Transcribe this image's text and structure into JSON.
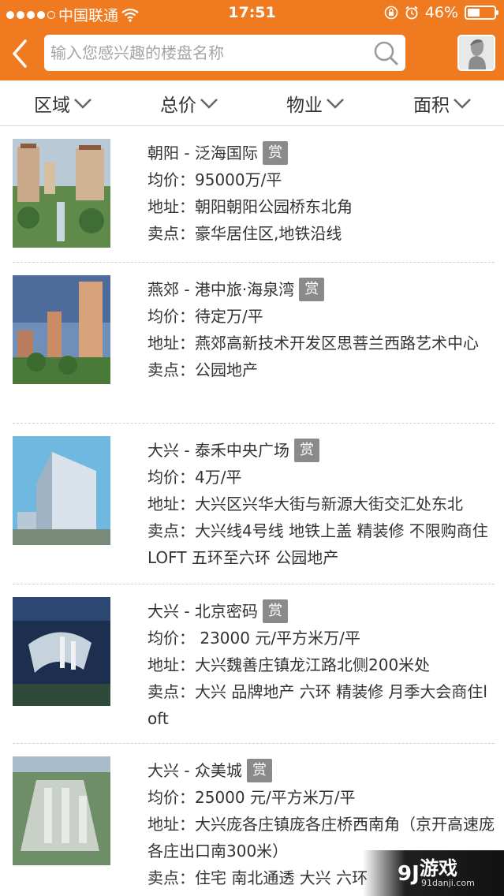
{
  "status_bar": {
    "carrier": "中国联通",
    "time": "17:51",
    "battery": "46%",
    "battery_level": 0.46
  },
  "search": {
    "placeholder": "输入您感兴趣的楼盘名称"
  },
  "filters": [
    "区域",
    "总价",
    "物业",
    "面积"
  ],
  "listings": [
    {
      "title": "朝阳 - 泛海国际",
      "badge": "赏",
      "lines": [
        "均价：95000万/平",
        "地址：朝阳朝阳公园桥东北角",
        "卖点：豪华居住区,地铁沿线"
      ]
    },
    {
      "title": "燕郊 - 港中旅·海泉湾",
      "badge": "赏",
      "lines": [
        "均价：待定万/平",
        "地址：燕郊高新技术开发区思菩兰西路艺术中心",
        "卖点：公园地产"
      ]
    },
    {
      "title": "大兴 - 泰禾中央广场",
      "badge": "赏",
      "lines": [
        "均价：4万/平",
        "地址：大兴区兴华大街与新源大街交汇处东北",
        "卖点：大兴线4号线 地铁上盖 精装修 不限购商住LOFT 五环至六环 公园地产"
      ]
    },
    {
      "title": "大兴 - 北京密码",
      "badge": "赏",
      "lines": [
        "均价： 23000 元/平方米万/平",
        "地址：大兴魏善庄镇龙江路北侧200米处",
        "卖点：大兴 品牌地产 六环 精装修 月季大会商住loft"
      ]
    },
    {
      "title": "大兴 - 众美城",
      "badge": "赏",
      "lines": [
        "均价：25000 元/平方米万/平",
        "地址：大兴庞各庄镇庞各庄桥西南角（京开高速庞各庄出口南300米）",
        "卖点：住宅 南北通透 大兴 六环"
      ]
    }
  ],
  "watermark": {
    "name": "游戏",
    "url": "91danji.com"
  },
  "colors": {
    "header": "#f07a1f",
    "badge": "#8a8a8a"
  }
}
